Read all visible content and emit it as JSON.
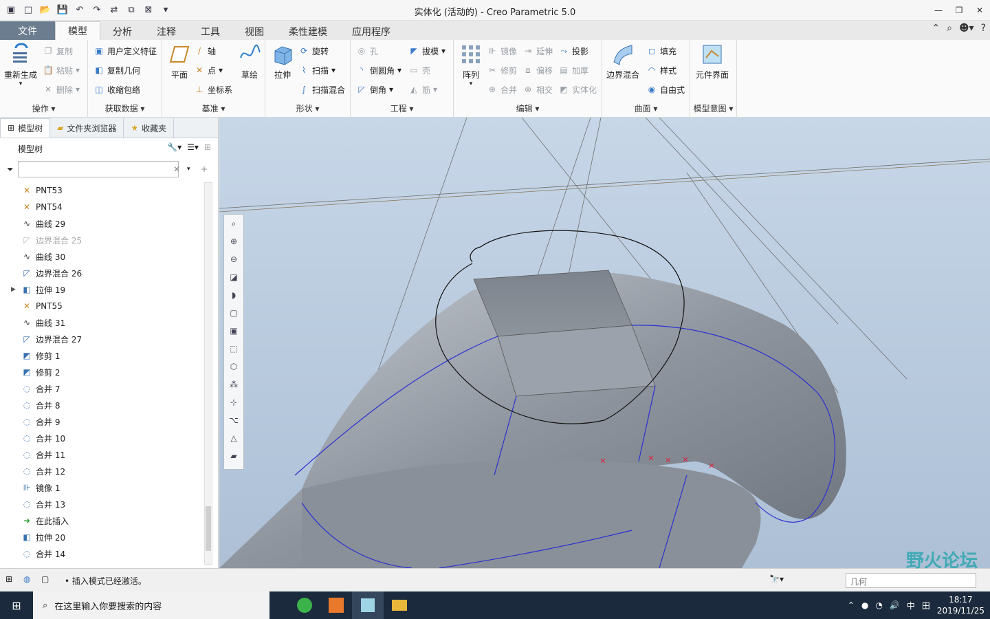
{
  "window": {
    "title": "实体化 (活动的) - Creo Parametric 5.0"
  },
  "quick_access": [
    "app-icon",
    "new-icon",
    "open-icon",
    "save-icon",
    "undo-icon",
    "redo-icon",
    "regenerate-icon",
    "window-icon",
    "close-window-icon",
    "customize-icon"
  ],
  "tabs": [
    {
      "label": "文件"
    },
    {
      "label": "模型"
    },
    {
      "label": "分析"
    },
    {
      "label": "注释"
    },
    {
      "label": "工具"
    },
    {
      "label": "视图"
    },
    {
      "label": "柔性建模"
    },
    {
      "label": "应用程序"
    }
  ],
  "ribbon": {
    "operations": {
      "label": "操作",
      "regen": "重新生成",
      "copy": "复制",
      "paste": "粘贴",
      "delete": "删除"
    },
    "getdata": {
      "label": "获取数据",
      "udf": "用户定义特征",
      "copygeom": "复制几何",
      "shrinkwrap": "收缩包络"
    },
    "datum": {
      "label": "基准",
      "plane": "平面",
      "axis": "轴",
      "point": "点",
      "csys": "坐标系",
      "sketch": "草绘"
    },
    "shapes": {
      "label": "形状",
      "extrude": "拉伸",
      "revolve": "旋转",
      "sweep": "扫描",
      "sweptblend": "扫描混合"
    },
    "engineering": {
      "label": "工程",
      "hole": "孔",
      "draft": "拔模",
      "round": "倒圆角",
      "shell": "壳",
      "chamfer": "倒角",
      "rib": "筋"
    },
    "edit": {
      "label": "编辑",
      "pattern": "阵列",
      "mirror": "镜像",
      "extend": "延伸",
      "project": "投影",
      "trim": "修剪",
      "offset": "偏移",
      "thicken": "加厚",
      "merge": "合并",
      "intersect": "相交",
      "solidify": "实体化"
    },
    "surfaces": {
      "label": "曲面",
      "boundary": "边界混合",
      "fill": "填充",
      "style": "样式",
      "freestyle": "自由式"
    },
    "intent": {
      "label": "模型意图",
      "component": "元件界面"
    }
  },
  "nav": {
    "tabs": [
      "模型树",
      "文件夹浏览器",
      "收藏夹"
    ],
    "tree_title": "模型树",
    "filter_placeholder": "",
    "items": [
      {
        "label": "PNT53",
        "icon": "point-icon",
        "dis": false
      },
      {
        "label": "PNT54",
        "icon": "point-icon",
        "dis": false
      },
      {
        "label": "曲线 29",
        "icon": "curve-icon",
        "dis": false
      },
      {
        "label": "边界混合 25",
        "icon": "boundary-blend-icon",
        "dis": true
      },
      {
        "label": "曲线 30",
        "icon": "curve-icon",
        "dis": false
      },
      {
        "label": "边界混合 26",
        "icon": "boundary-blend-icon",
        "dis": false
      },
      {
        "label": "拉伸 19",
        "icon": "extrude-icon",
        "dis": false,
        "expandable": true
      },
      {
        "label": "PNT55",
        "icon": "point-icon",
        "dis": false
      },
      {
        "label": "曲线 31",
        "icon": "curve-icon",
        "dis": false
      },
      {
        "label": "边界混合 27",
        "icon": "boundary-blend-icon",
        "dis": false
      },
      {
        "label": "修剪 1",
        "icon": "trim-icon",
        "dis": false
      },
      {
        "label": "修剪 2",
        "icon": "trim-icon",
        "dis": false
      },
      {
        "label": "合并 7",
        "icon": "merge-icon",
        "dis": false
      },
      {
        "label": "合并 8",
        "icon": "merge-icon",
        "dis": false
      },
      {
        "label": "合并 9",
        "icon": "merge-icon",
        "dis": false
      },
      {
        "label": "合并 10",
        "icon": "merge-icon",
        "dis": false
      },
      {
        "label": "合并 11",
        "icon": "merge-icon",
        "dis": false
      },
      {
        "label": "合并 12",
        "icon": "merge-icon",
        "dis": false
      },
      {
        "label": "镜像 1",
        "icon": "mirror-icon",
        "dis": false
      },
      {
        "label": "合并 13",
        "icon": "merge-icon",
        "dis": false
      },
      {
        "label": "在此插入",
        "icon": "insert-arrow-icon",
        "dis": false
      },
      {
        "label": "拉伸 20",
        "icon": "extrude-icon",
        "dis": false
      },
      {
        "label": "合并 14",
        "icon": "merge-icon",
        "dis": false
      }
    ]
  },
  "status": {
    "message": "• 插入模式已经激活。",
    "selection_filter": "几何"
  },
  "taskbar": {
    "search_placeholder": "在这里输入你要搜索的内容",
    "time": "18:17",
    "date": "2019/11/25",
    "ime": "中"
  },
  "watermark": "野火论坛"
}
